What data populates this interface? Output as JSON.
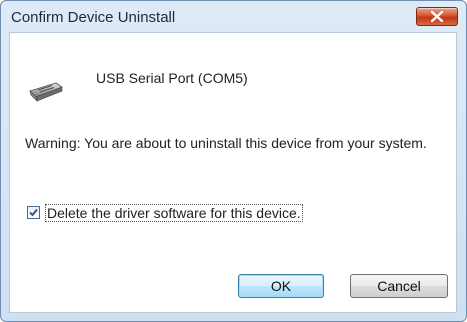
{
  "window": {
    "title": "Confirm Device Uninstall"
  },
  "device": {
    "name": "USB Serial Port (COM5)",
    "icon": "usb-device-icon"
  },
  "message": {
    "warning": "Warning: You are about to uninstall this device from your system."
  },
  "option": {
    "checked": true,
    "label": "Delete the driver software for this device."
  },
  "buttons": {
    "ok_label": "OK",
    "cancel_label": "Cancel"
  },
  "colors": {
    "title_bg": "#dfeaf6",
    "close_red": "#c2361a",
    "default_button_border": "#3c7fb1"
  }
}
